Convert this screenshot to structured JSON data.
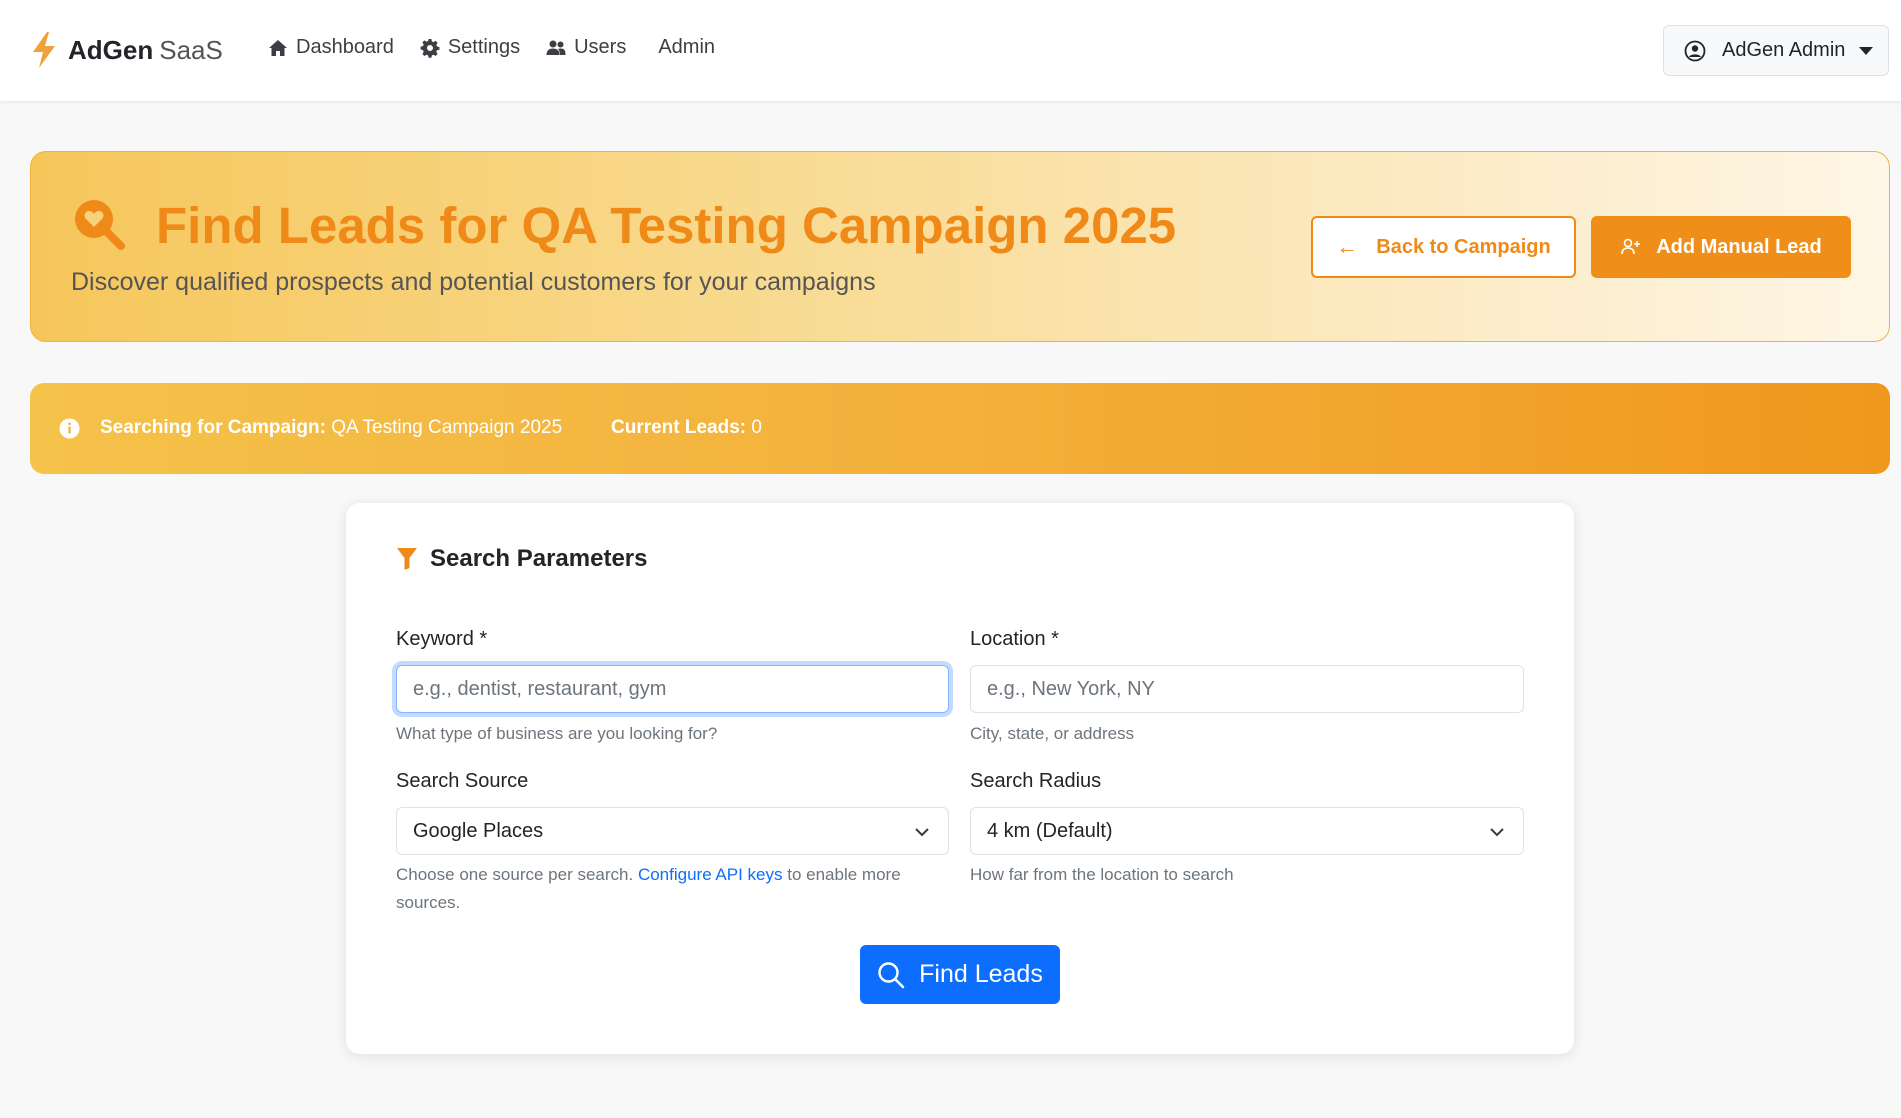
{
  "navbar": {
    "brand_name": "AdGen",
    "brand_suffix": "SaaS",
    "links": [
      {
        "label": "Dashboard",
        "icon": "home-icon"
      },
      {
        "label": "Settings",
        "icon": "gear-icon"
      },
      {
        "label": "Users",
        "icon": "users-icon"
      },
      {
        "label": "Admin",
        "icon": ""
      }
    ],
    "user_label": "AdGen Admin"
  },
  "hero": {
    "title": "Find Leads for QA Testing Campaign 2025",
    "subtitle": "Discover qualified prospects and potential customers for your campaigns",
    "back_label": "Back to Campaign",
    "add_label": "Add Manual Lead"
  },
  "alert": {
    "campaign_label": "Searching for Campaign:",
    "campaign_value": "QA Testing Campaign 2025",
    "leads_label": "Current Leads:",
    "leads_value": "0"
  },
  "search": {
    "title": "Search Parameters",
    "keyword_label": "Keyword *",
    "keyword_placeholder": "e.g., dentist, restaurant, gym",
    "keyword_help": "What type of business are you looking for?",
    "location_label": "Location *",
    "location_placeholder": "e.g., New York, NY",
    "location_help": "City, state, or address",
    "source_label": "Search Source",
    "source_value": "Google Places",
    "source_help_prefix": "Choose one source per search.",
    "source_help_link": "Configure API keys",
    "source_help_suffix": "to enable more sources.",
    "radius_label": "Search Radius",
    "radius_value": "4 km (Default)",
    "radius_help": "How far from the location to search",
    "find_label": "Find Leads"
  },
  "colors": {
    "accent": "#ef8a18",
    "primary": "#0d6efd"
  }
}
